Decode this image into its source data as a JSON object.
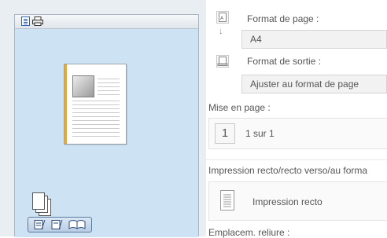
{
  "settings": {
    "paper_size_label": "Format de page :",
    "paper_size_value": "A4",
    "output_size_label": "Format de sortie :",
    "output_size_value": "Ajuster au format de page",
    "layout_label": "Mise en page :",
    "layout_icon_number": "1",
    "layout_value": "1 sur 1",
    "duplex_label": "Impression recto/recto verso/au forma",
    "duplex_value": "Impression recto",
    "binding_label": "Emplacem. reliure :"
  },
  "icons": {
    "view_toggle_doc": "document-icon",
    "view_toggle_printer": "printer-icon",
    "paper_size": "paper-size-icon",
    "output_size": "output-size-icon",
    "copies": "copies-stack-icon",
    "duplex": "one-sided-page-icon"
  }
}
